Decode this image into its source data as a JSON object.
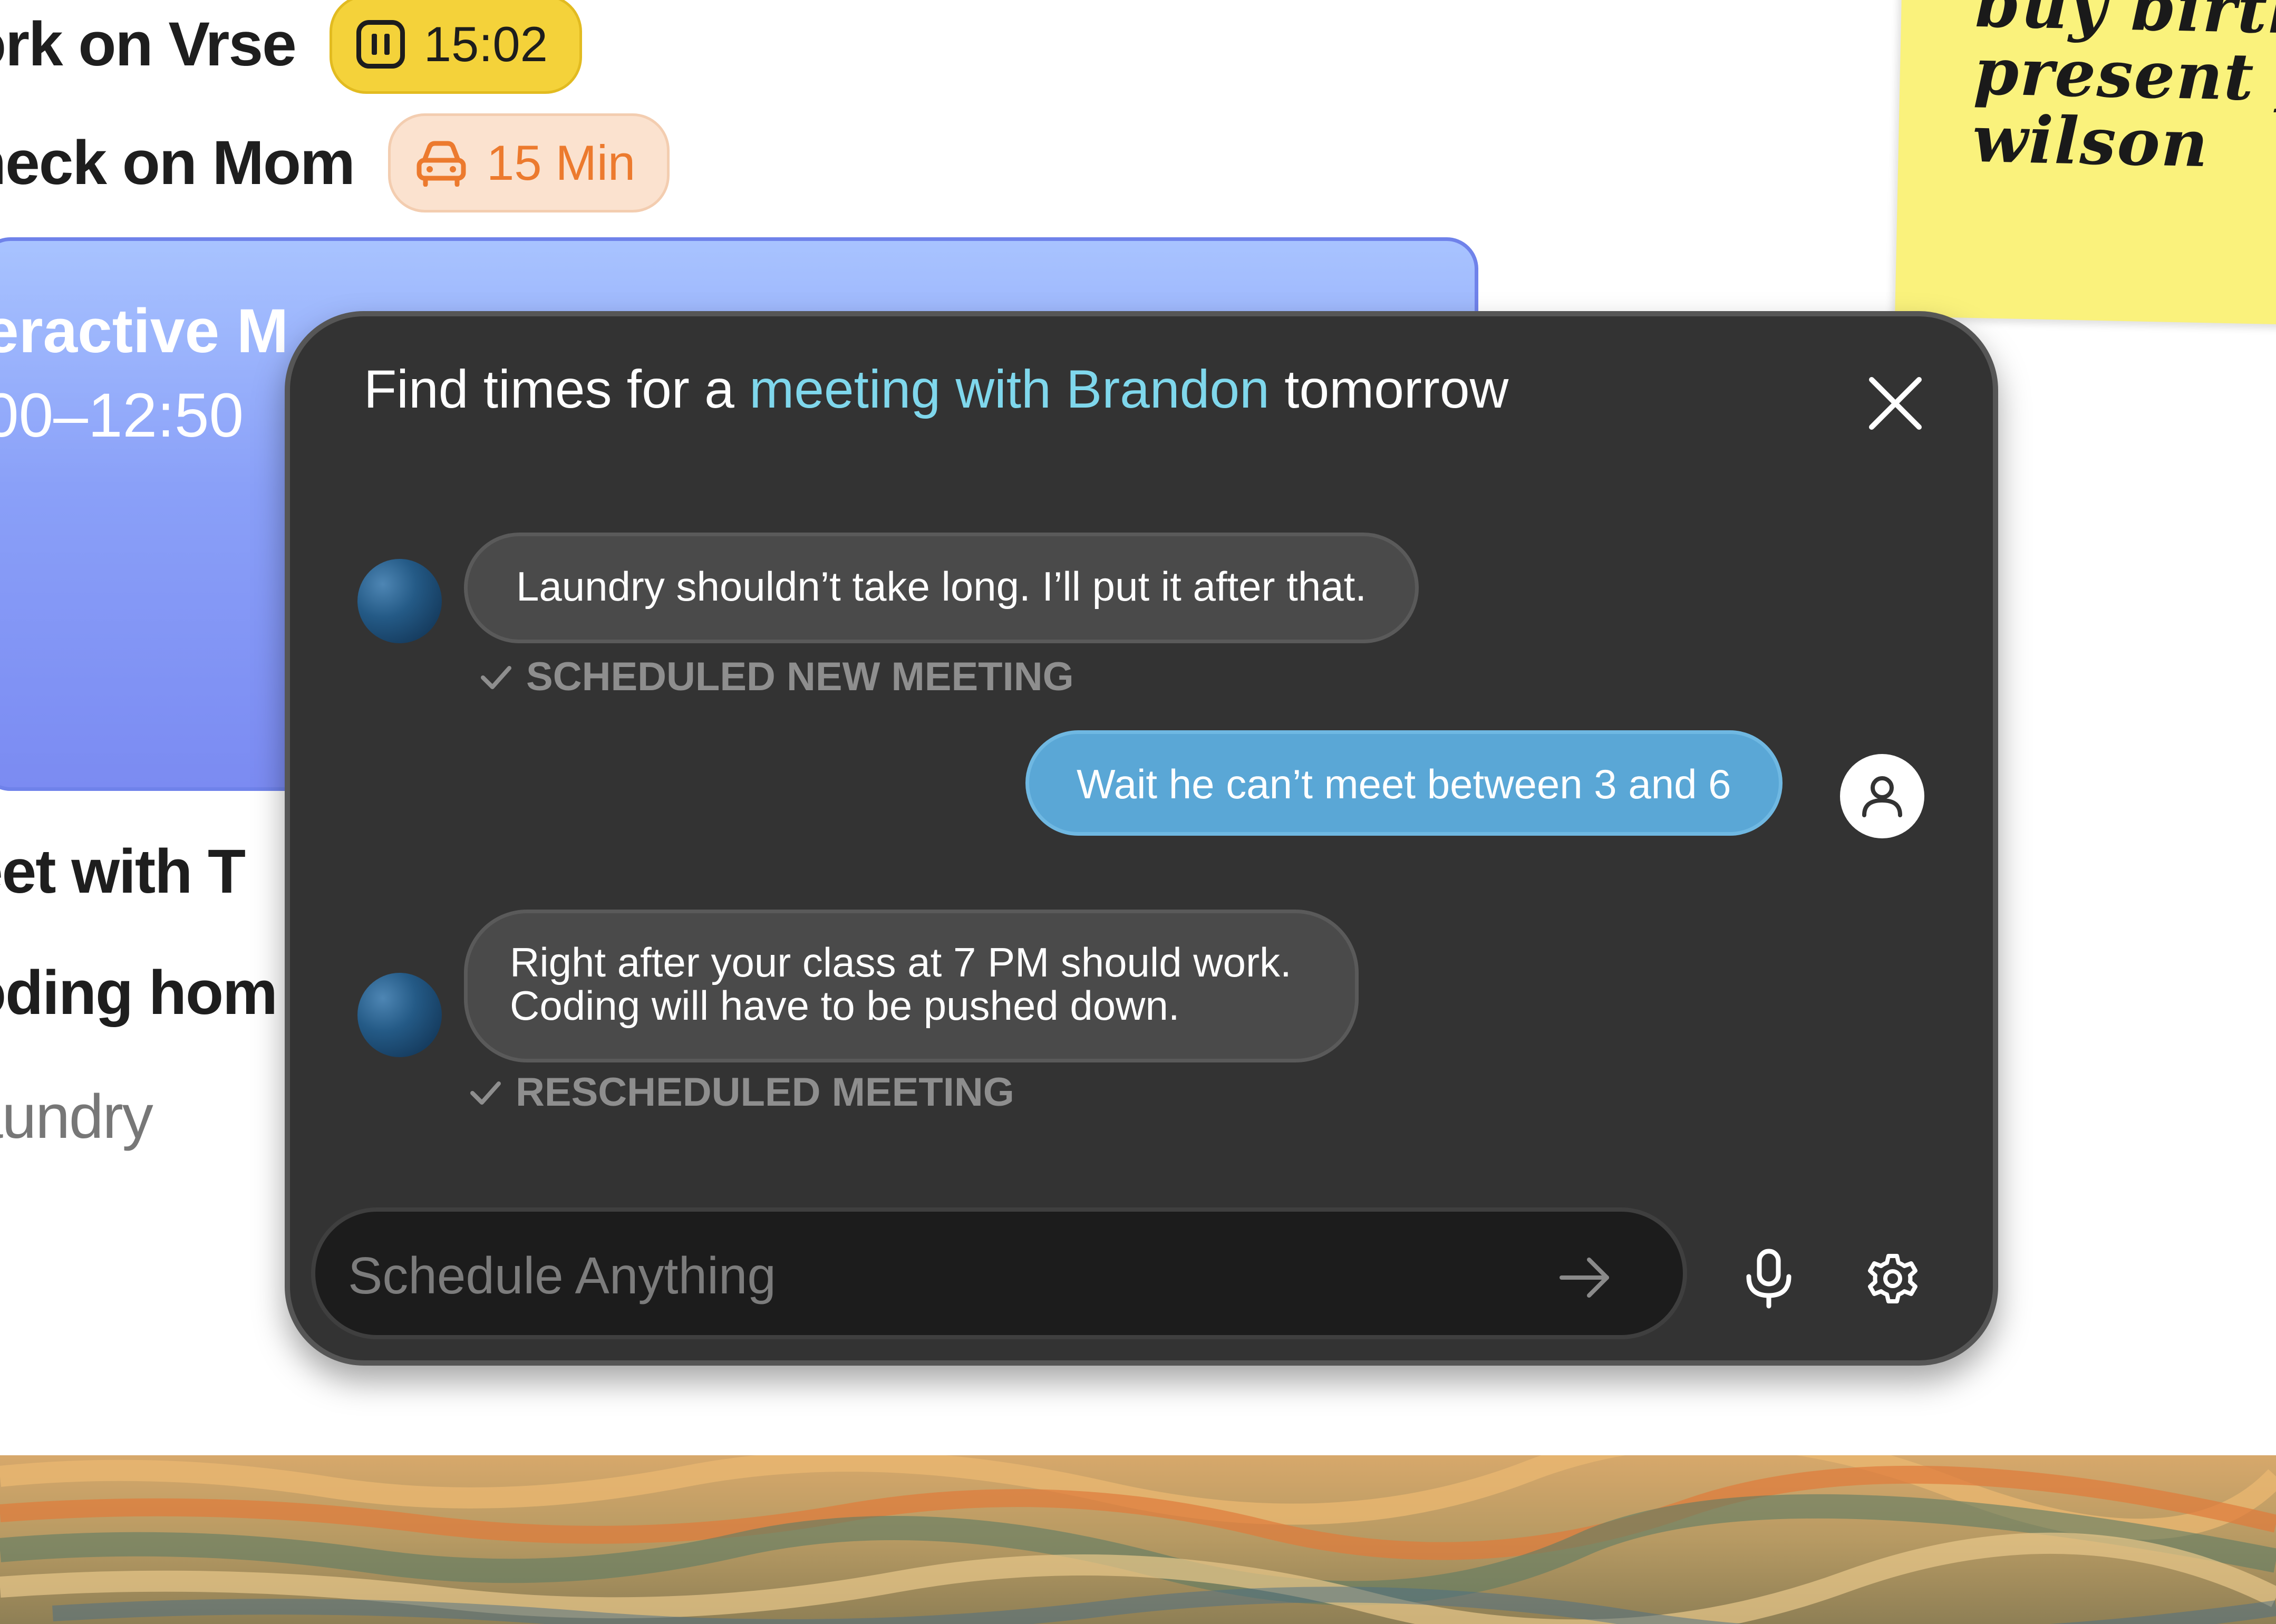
{
  "background": {
    "tasks": [
      {
        "label": "ork on Vrse",
        "pill": {
          "icon": "pause-icon",
          "text": "15:02"
        }
      },
      {
        "label": "heck on Mom",
        "pill": {
          "icon": "car-icon",
          "text": "15 Min"
        }
      }
    ],
    "event": {
      "title": "eractive M",
      "time": "00–12:50"
    },
    "more_tasks": [
      "eet with T",
      "oding hom",
      "aundry"
    ],
    "sticky_note": "buy birth\npresent fo\nwilson"
  },
  "panel": {
    "prompt": {
      "pre": "Find times for a ",
      "highlight": "meeting with Brandon",
      "post": " tomorrow"
    },
    "messages": [
      {
        "from": "assistant",
        "text": "Laundry shouldn’t take long. I’ll put it after that.",
        "status": "SCHEDULED NEW MEETING"
      },
      {
        "from": "user",
        "text": "Wait he can’t meet between 3 and 6"
      },
      {
        "from": "assistant",
        "text_line1": "Right after your class at 7 PM should work.",
        "text_line2": "Coding will have to be pushed down.",
        "status": "RESCHEDULED MEETING"
      }
    ],
    "input": {
      "placeholder": "Schedule Anything",
      "value": ""
    }
  },
  "colors": {
    "panel_bg": "#333333",
    "highlight": "#7fd7ec",
    "user_bubble": "#5aa7d6",
    "timer_pill": "#f4d23a",
    "drive_pill": "#fbe2cf",
    "event_card": "#8aa0f8",
    "sticky": "#faf27c"
  }
}
